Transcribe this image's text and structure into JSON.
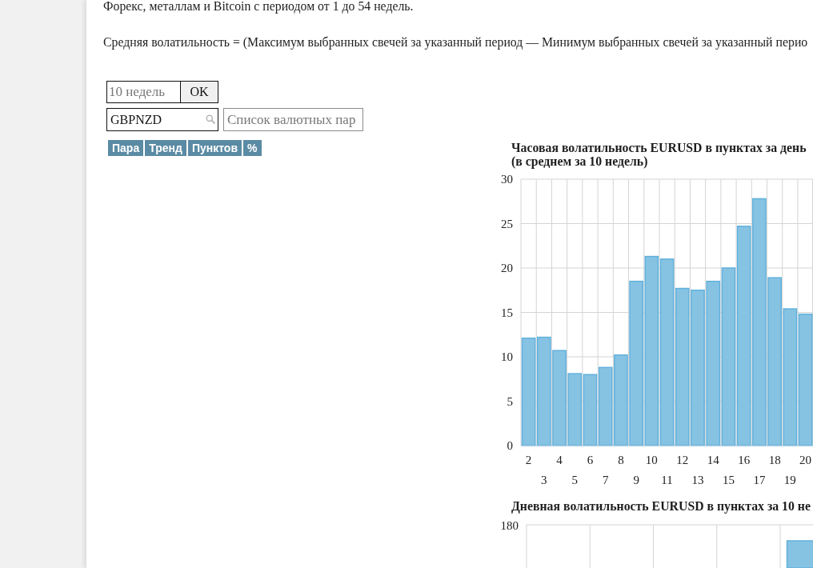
{
  "description": {
    "intro": "Форекс, металлам и Bitcoin с периодом от 1 до 54 недель.",
    "formula": "Средняя волатильность = (Максимум выбранных свечей за указанный период — Минимум выбранных свечей за указанный перио"
  },
  "period_form": {
    "weeks_field": {
      "placeholder": "10 недель"
    },
    "ok_button": "OK"
  },
  "pair_search": {
    "value": "GBPNZD"
  },
  "pair_list_field": {
    "placeholder": "Список валютных пар"
  },
  "table": {
    "columns": [
      "Пара",
      "Тренд",
      "Пунктов",
      "%"
    ]
  },
  "hourly_chart": {
    "chart_data": {
      "type": "bar",
      "title": "Часовая волатильность EURUSD в пунктах за день",
      "subtitle": "(в среднем за 10 недель)",
      "categories": [
        "2",
        "3",
        "4",
        "5",
        "6",
        "7",
        "8",
        "9",
        "10",
        "11",
        "12",
        "13",
        "14",
        "15",
        "16",
        "17",
        "18",
        "19",
        "20"
      ],
      "values": [
        12.1,
        12.2,
        10.7,
        8.1,
        8.0,
        8.8,
        10.2,
        18.5,
        21.3,
        21.0,
        17.7,
        17.5,
        18.5,
        20.0,
        24.7,
        27.8,
        18.9,
        15.4,
        14.8
      ],
      "color": "#86c3e3",
      "ylim": [
        0,
        30
      ],
      "yticks": [
        0,
        5,
        10,
        15,
        20,
        25,
        30
      ],
      "grid": true
    }
  },
  "daily_chart": {
    "title": "Дневная волатильность EURUSD в пунктах за 10 не",
    "top_tick_label": "180"
  }
}
